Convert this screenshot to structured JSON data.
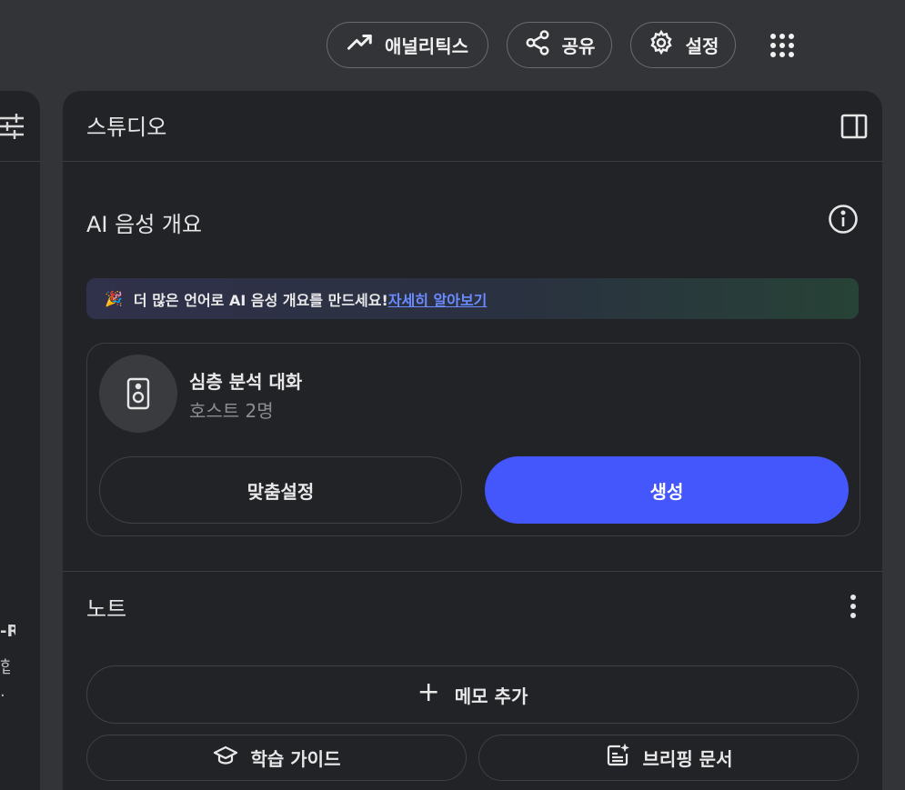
{
  "topbar": {
    "analytics_label": "애널리틱스",
    "share_label": "공유",
    "settings_label": "설정"
  },
  "left_panel": {
    "text_1": "-R",
    "text_2": "합",
    "text_3": "."
  },
  "studio": {
    "title": "스튜디오",
    "audio_overview": {
      "title": "AI 음성 개요",
      "banner_text": "더 많은 언어로 AI 음성 개요를 만드세요!",
      "banner_link": "자세히 알아보기",
      "card": {
        "title": "심층 분석 대화",
        "subtitle": "호스트 2명",
        "customize_label": "맞춤설정",
        "generate_label": "생성"
      }
    },
    "notes": {
      "title": "노트",
      "add_memo_label": "메모 추가",
      "study_guide_label": "학습 가이드",
      "briefing_doc_label": "브리핑 문서"
    }
  },
  "colors": {
    "background": "#333437",
    "panel": "#222327",
    "accent_blue": "#4357fd",
    "link_blue": "#6b8bff"
  }
}
